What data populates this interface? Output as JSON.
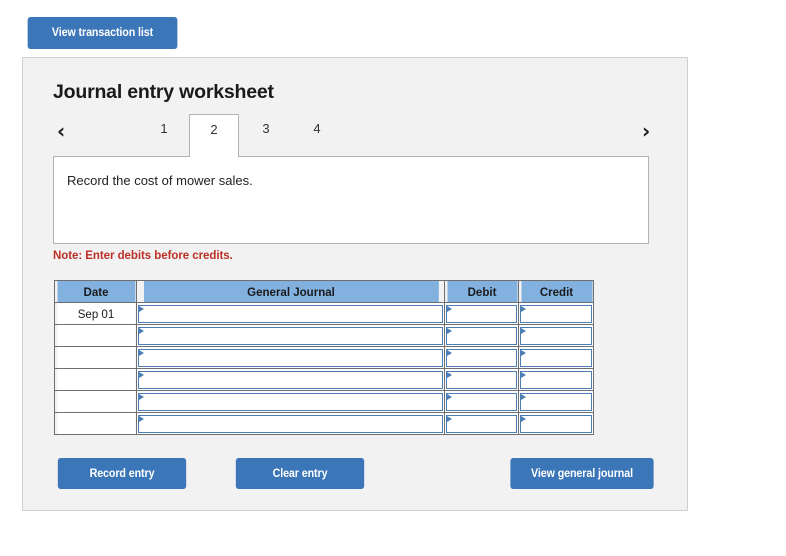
{
  "top_bar": {
    "view_transaction_list_label": "View transaction list"
  },
  "panel": {
    "title": "Journal entry worksheet",
    "nav": {
      "prev_icon": "chevron-left-icon",
      "next_icon": "chevron-right-icon",
      "prev_glyph": "‹",
      "next_glyph": "›"
    },
    "tabs": [
      {
        "label": "1",
        "active": false
      },
      {
        "label": "2",
        "active": true
      },
      {
        "label": "3",
        "active": false
      },
      {
        "label": "4",
        "active": false
      }
    ],
    "description": "Record the cost of mower sales.",
    "note": "Note: Enter debits before credits.",
    "table": {
      "headers": [
        "Date",
        "General Journal",
        "Debit",
        "Credit"
      ],
      "rows": [
        {
          "date": "Sep 01",
          "general_journal": "",
          "debit": "",
          "credit": ""
        },
        {
          "date": "",
          "general_journal": "",
          "debit": "",
          "credit": ""
        },
        {
          "date": "",
          "general_journal": "",
          "debit": "",
          "credit": ""
        },
        {
          "date": "",
          "general_journal": "",
          "debit": "",
          "credit": ""
        },
        {
          "date": "",
          "general_journal": "",
          "debit": "",
          "credit": ""
        },
        {
          "date": "",
          "general_journal": "",
          "debit": "",
          "credit": ""
        }
      ]
    },
    "actions": {
      "record_entry_label": "Record entry",
      "clear_entry_label": "Clear entry",
      "view_general_journal_label": "View general journal"
    }
  },
  "colors": {
    "button_blue": "#3b76b8",
    "table_header_blue": "#82b1e0",
    "cell_border_blue": "#4a7eb5",
    "note_red": "#bb3027",
    "panel_bg": "#f2f2f2",
    "panel_border": "#cfcfcf"
  }
}
